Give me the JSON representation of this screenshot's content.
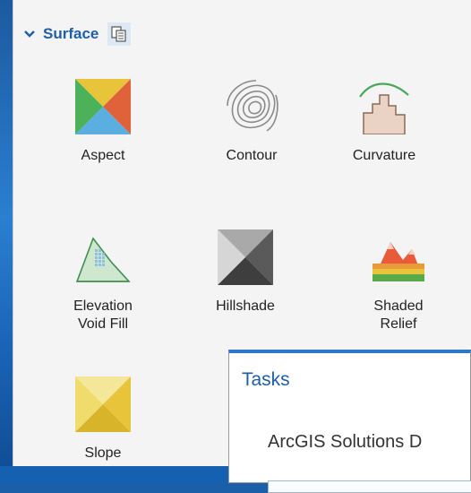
{
  "header": {
    "title": "Surface"
  },
  "tools": [
    {
      "label": "Aspect"
    },
    {
      "label": "Contour"
    },
    {
      "label": "Curvature"
    },
    {
      "label": "Elevation\nVoid Fill"
    },
    {
      "label": "Hillshade"
    },
    {
      "label": "Shaded\nRelief"
    },
    {
      "label": "Slope"
    }
  ],
  "tasks": {
    "title": "Tasks",
    "item": "ArcGIS Solutions D"
  },
  "colors": {
    "accent": "#1f5ea8",
    "panel_bg": "#f4f4f4",
    "desktop_bg": "#1a5fa8"
  }
}
